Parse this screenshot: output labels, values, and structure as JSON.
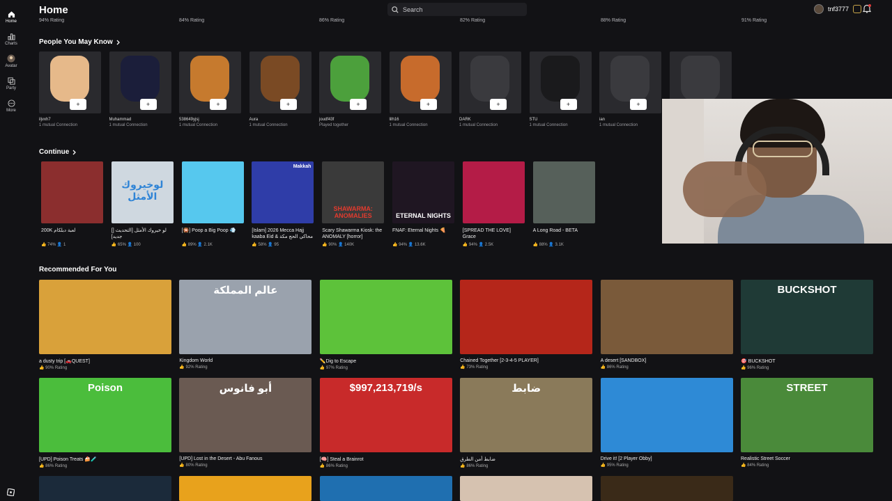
{
  "sidebar": {
    "items": [
      {
        "label": "Home",
        "icon": "home-icon"
      },
      {
        "label": "Charts",
        "icon": "charts-icon"
      },
      {
        "label": "Avatar",
        "icon": "avatar-icon"
      },
      {
        "label": "Party",
        "icon": "party-icon"
      },
      {
        "label": "More",
        "icon": "more-icon"
      }
    ]
  },
  "header": {
    "title": "Home",
    "search_placeholder": "Search",
    "username": "tnf3777"
  },
  "top_ratings": [
    "94% Rating",
    "84% Rating",
    "86% Rating",
    "82% Rating",
    "88% Rating",
    "91% Rating"
  ],
  "people": {
    "heading": "People You May Know",
    "items": [
      {
        "name": "iljvxh7",
        "sub": "1 mutual Connection",
        "color": "#e6b98a"
      },
      {
        "name": "Muhammad",
        "sub": "1 mutual Connection",
        "color": "#1b1e3a"
      },
      {
        "name": "538649yjsj",
        "sub": "1 mutual Connection",
        "color": "#c67a2e"
      },
      {
        "name": "Aura",
        "sub": "1 mutual Connection",
        "color": "#7a4a24"
      },
      {
        "name": "joudf43f",
        "sub": "Played together",
        "color": "#4ca03c"
      },
      {
        "name": "lilh16",
        "sub": "1 mutual Connection",
        "color": "#c76b2c"
      },
      {
        "name": "DARK",
        "sub": "1 mutual Connection",
        "color": "#3a3a3e"
      },
      {
        "name": "STU",
        "sub": "1 mutual Connection",
        "color": "#1a1a1c"
      },
      {
        "name": "ian",
        "sub": "1 mutual Connection",
        "color": "#3a3a3e"
      },
      {
        "name": "",
        "sub": "",
        "color": "#3a3a3e"
      }
    ]
  },
  "continue": {
    "heading": "Continue",
    "items": [
      {
        "title": "200K لعبة دبلكام",
        "rating": "74%",
        "players": "1",
        "color": "#8b2e2e"
      },
      {
        "title": "[] لو خيروك الأمثل [التحديث جديد]",
        "rating": "65%",
        "players": "100",
        "color": "#cfd8e0"
      },
      {
        "title": "[🎇] Poop a Big Poop 💨",
        "rating": "89%",
        "players": "2.1K",
        "color": "#56c8ee"
      },
      {
        "title": "[Islam] 2026 Mecca Hajj kaaba Eid & محاكي الحج مكة",
        "rating": "58%",
        "players": "95",
        "color": "#2f3da8"
      },
      {
        "title": "Scary Shawarma Kiosk: the ANOMALY [horror]",
        "rating": "90%",
        "players": "140K",
        "color": "#3a3a3a"
      },
      {
        "title": "FNAF: Eternal Nights 🍕",
        "rating": "94%",
        "players": "13.6K",
        "color": "#1f1622"
      },
      {
        "title": "[SPREAD THE LOVE] Grace",
        "rating": "94%",
        "players": "2.5K",
        "color": "#b41c47"
      },
      {
        "title": "A Long Road - BETA",
        "rating": "88%",
        "players": "3.1K",
        "color": "#56605a"
      }
    ]
  },
  "recommended": {
    "heading": "Recommended For You",
    "row1": [
      {
        "title": "a dusty trip [🚗QUEST]",
        "rating": "90% Rating",
        "color": "#d9a13a"
      },
      {
        "title": "Kingdom World",
        "rating": "92% Rating",
        "color": "#9aa2ad"
      },
      {
        "title": "✏️Dig to Escape",
        "rating": "97% Rating",
        "color": "#5dc23a"
      },
      {
        "title": "Chained Together [2-3-4-5 PLAYER]",
        "rating": "73% Rating",
        "color": "#b5261a"
      },
      {
        "title": "A desert [SANDBOX]",
        "rating": "86% Rating",
        "color": "#7a5a3a"
      },
      {
        "title": "🎯 BUCKSHOT",
        "rating": "96% Rating",
        "color": "#1f3a36"
      }
    ],
    "row2": [
      {
        "title": "[UPD] Poison Treats 🍰🧪",
        "rating": "86% Rating",
        "color": "#4bbd3c"
      },
      {
        "title": "[UPD] Lost in the Desert - Abu Fanous",
        "rating": "80% Rating",
        "color": "#6a5a52"
      },
      {
        "title": "[🧠] Steal a Brainrot",
        "rating": "86% Rating",
        "color": "#c82a2a"
      },
      {
        "title": "ضابط أمن الطرق",
        "rating": "86% Rating",
        "color": "#8a7a5a"
      },
      {
        "title": "Drive it! [2 Player Obby]",
        "rating": "95% Rating",
        "color": "#2e8ad6"
      },
      {
        "title": "Realistic Street Soccer",
        "rating": "84% Rating",
        "color": "#4a8a3a"
      }
    ],
    "row3_colors": [
      "#1b2a3a",
      "#e8a21c",
      "#1f6fb0",
      "#d6c2b0",
      "#3a2a18",
      "#121215"
    ],
    "thumb_texts": {
      "kingdom": "عالم المملكة",
      "poison": "Poison",
      "abu": "أبو فانوس",
      "brainrot": "$997,213,719/s",
      "dabit": "ضابط",
      "street": "STREET",
      "buckshot": "BUCKSHOT"
    }
  },
  "continue_thumb_texts": {
    "shawarma": "SHAWARMA: ANOMALIES",
    "fnaf": "ETERNAL NIGHTS",
    "mecca": "Makkah",
    "lokhay": "لوخيروك الأمثل"
  }
}
